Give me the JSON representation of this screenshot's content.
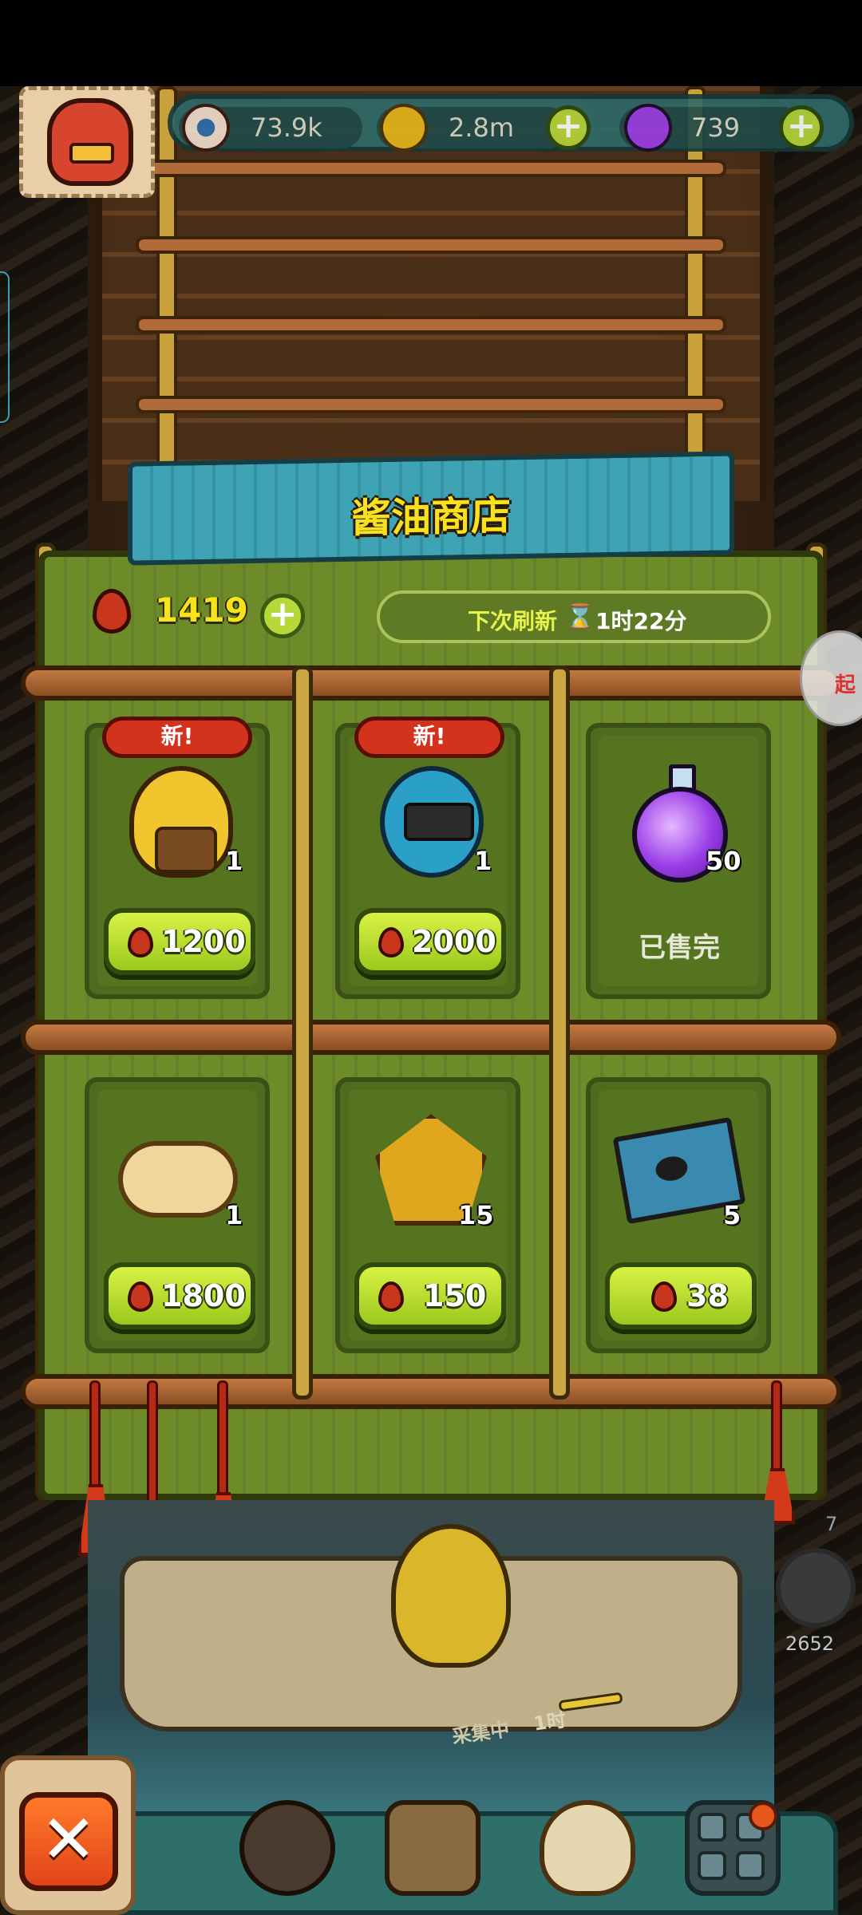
{
  "hud": {
    "eyes": "73.9k",
    "coins": "2.8m",
    "potions": "739",
    "icons": {
      "eyes": "eyeball-icon",
      "coins": "coin-icon",
      "potions": "potion-icon",
      "add": "plus-icon"
    }
  },
  "shop": {
    "title": "酱油商店",
    "currency": "1419",
    "add_button": "+",
    "refresh_label": "下次刷新",
    "refresh_time": "1时22分",
    "items": [
      {
        "art": "yellow-chick-monster",
        "badge": "新!",
        "quantity": "1",
        "price": "1200"
      },
      {
        "art": "blue-fish-monster",
        "badge": "新!",
        "quantity": "1",
        "price": "2000"
      },
      {
        "art": "purple-potion",
        "quantity": "50",
        "status": "已售完"
      },
      {
        "art": "golden-cloud-creature",
        "quantity": "1",
        "price": "1800"
      },
      {
        "art": "amber-gem",
        "quantity": "15",
        "price": "150"
      },
      {
        "art": "treasure-map",
        "quantity": "5",
        "price": "38"
      }
    ]
  },
  "scene": {
    "collect_label": "采集中",
    "collect_time": "1时",
    "side_count_top": "7",
    "side_count": "2652",
    "bubble_text": "起"
  },
  "controls": {
    "close": "✕"
  },
  "colors": {
    "accent_yellow": "#f7e21c",
    "button_green": "#b6d83a",
    "badge_red": "#d3331c",
    "panel_green": "#6e8b2a"
  }
}
